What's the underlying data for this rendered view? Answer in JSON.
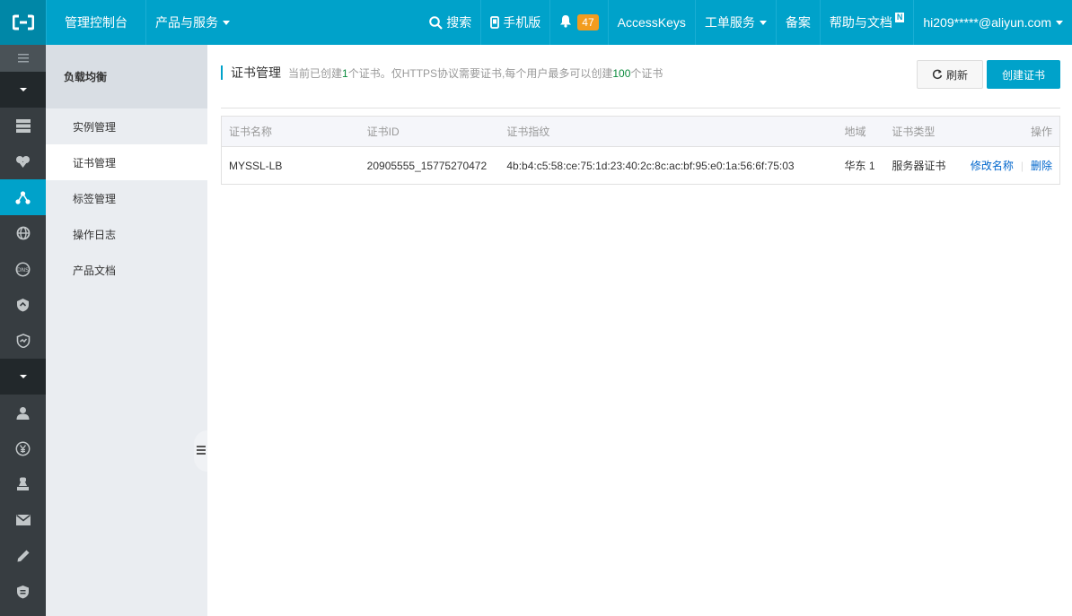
{
  "topbar": {
    "console": "管理控制台",
    "products": "产品与服务",
    "search": "搜索",
    "mobile": "手机版",
    "notifications_count": "47",
    "accesskeys": "AccessKeys",
    "tickets": "工单服务",
    "filing": "备案",
    "help": "帮助与文档",
    "help_badge": "N",
    "account": "hi209*****@aliyun.com"
  },
  "iconbar": {
    "icons": [
      "menu-icon",
      "collapse-arrow-icon",
      "server-icon",
      "cloud-icon",
      "load-balancer-icon",
      "globe-icon",
      "dns-icon",
      "shield-icon",
      "monitor-icon",
      "collapse-arrow-icon",
      "user-icon",
      "yen-icon",
      "seal-icon",
      "mail-icon",
      "pencil-icon",
      "badge-icon"
    ]
  },
  "subnav": {
    "title": "负载均衡",
    "items": [
      {
        "label": "实例管理"
      },
      {
        "label": "证书管理"
      },
      {
        "label": "标签管理"
      },
      {
        "label": "操作日志"
      },
      {
        "label": "产品文档"
      }
    ]
  },
  "main": {
    "title": "证书管理",
    "desc_prefix": "当前已创建",
    "desc_count": "1",
    "desc_middle": "个证书。仅HTTPS协议需要证书,每个用户最多可以创建",
    "desc_max": "100",
    "desc_suffix": "个证书",
    "refresh_label": "刷新",
    "create_label": "创建证书"
  },
  "table": {
    "headers": [
      "证书名称",
      "证书ID",
      "证书指纹",
      "地域",
      "证书类型",
      "操作"
    ],
    "rows": [
      {
        "name": "MYSSL-LB",
        "id": "20905555_15775270472",
        "fingerprint": "4b:b4:c5:58:ce:75:1d:23:40:2c:8c:ac:bf:95:e0:1a:56:6f:75:03",
        "region": "华东 1",
        "type": "服务器证书",
        "action_rename": "修改名称",
        "action_separator": "|",
        "action_delete": "删除"
      }
    ]
  },
  "colors": {
    "primary": "#00a2ca",
    "iconbar_bg": "#373d41",
    "link": "#0066cc",
    "badge": "#f29c1e",
    "highlight_number": "#0a8a3c"
  }
}
